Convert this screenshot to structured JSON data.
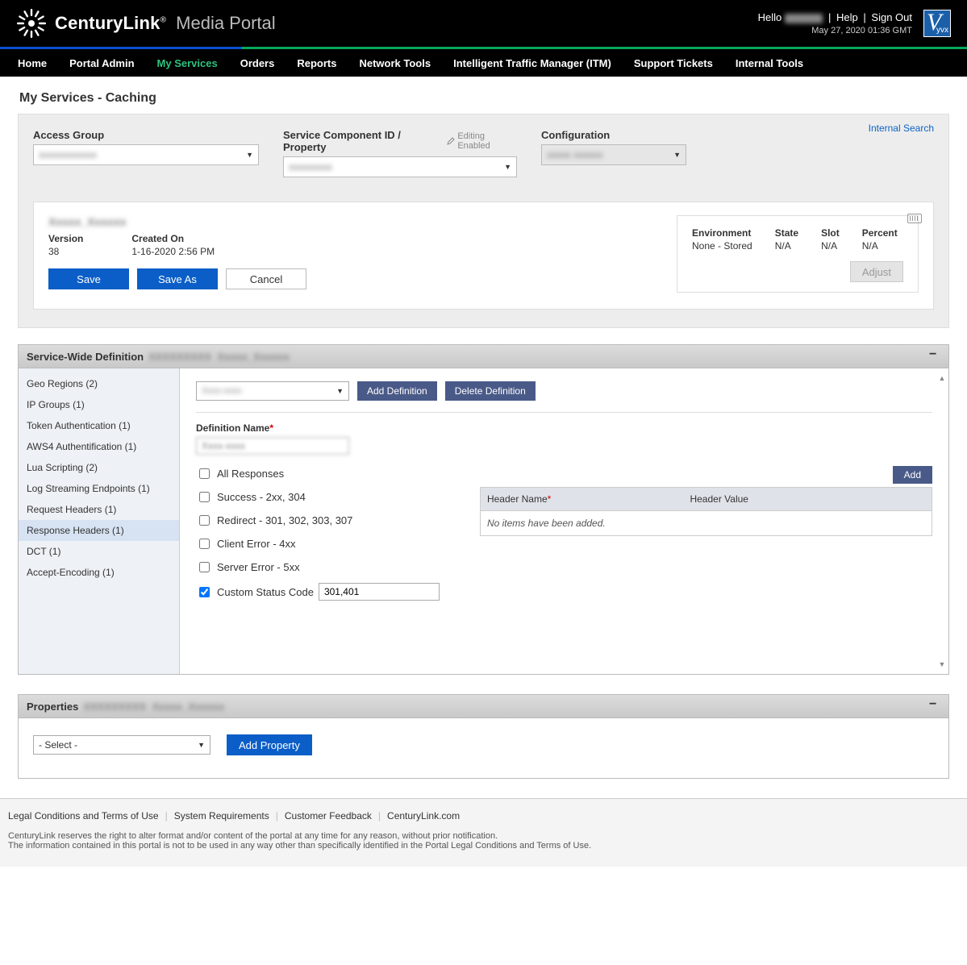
{
  "header": {
    "brand_main": "CenturyLink",
    "brand_sub": "Media Portal",
    "hello": "Hello",
    "help": "Help",
    "signout": "Sign Out",
    "timestamp": "May 27, 2020 01:36 GMT"
  },
  "nav": {
    "items": [
      "Home",
      "Portal Admin",
      "My Services",
      "Orders",
      "Reports",
      "Network Tools",
      "Intelligent Traffic Manager (ITM)",
      "Support Tickets",
      "Internal Tools"
    ],
    "active_index": 2
  },
  "page_title": "My Services - Caching",
  "internal_search": "Internal Search",
  "selectors": {
    "access_group_label": "Access Group",
    "scid_label": "Service Component ID / Property",
    "editing_enabled": "Editing Enabled",
    "configuration_label": "Configuration"
  },
  "config_box": {
    "version_label": "Version",
    "version_value": "38",
    "created_label": "Created On",
    "created_value": "1-16-2020 2:56 PM",
    "save": "Save",
    "save_as": "Save As",
    "cancel": "Cancel",
    "env_label": "Environment",
    "env_value": "None - Stored",
    "state_label": "State",
    "state_value": "N/A",
    "slot_label": "Slot",
    "slot_value": "N/A",
    "percent_label": "Percent",
    "percent_value": "N/A",
    "adjust": "Adjust"
  },
  "swd": {
    "title": "Service-Wide Definition",
    "tabs": [
      "Geo Regions (2)",
      "IP Groups (1)",
      "Token Authentication (1)",
      "AWS4 Authentification (1)",
      "Lua Scripting (2)",
      "Log Streaming Endpoints (1)",
      "Request Headers (1)",
      "Response Headers (1)",
      "DCT (1)",
      "Accept-Encoding (1)"
    ],
    "active_tab_index": 7,
    "add_def": "Add Definition",
    "del_def": "Delete Definition",
    "def_name_label": "Definition Name",
    "checks": {
      "all": "All Responses",
      "success": "Success - 2xx, 304",
      "redirect": "Redirect - 301, 302, 303, 307",
      "client": "Client Error - 4xx",
      "server": "Server Error - 5xx",
      "custom": "Custom Status Code",
      "custom_value": "301,401"
    },
    "add": "Add",
    "hdr_name": "Header Name",
    "hdr_value": "Header Value",
    "empty_row": "No items have been added."
  },
  "props": {
    "title": "Properties",
    "select_placeholder": "- Select -",
    "add_property": "Add Property"
  },
  "footer": {
    "links": [
      "Legal Conditions and Terms of Use",
      "System Requirements",
      "Customer Feedback",
      "CenturyLink.com"
    ],
    "line1": "CenturyLink reserves the right to alter format and/or content of the portal at any time for any reason, without prior notification.",
    "line2": "The information contained in this portal is not to be used in any way other than specifically identified in the Portal Legal Conditions and Terms of Use."
  }
}
